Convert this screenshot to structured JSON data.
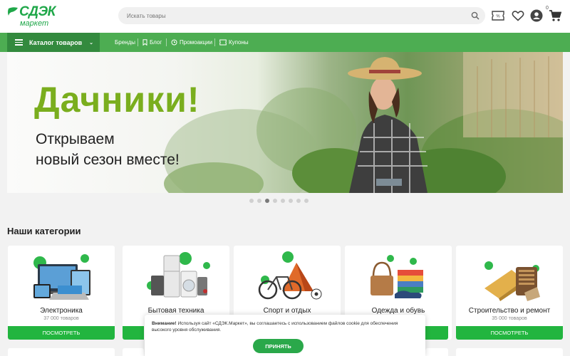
{
  "brand": {
    "name": "СДЭК",
    "sub": "маркет",
    "color": "#1fa749"
  },
  "search": {
    "placeholder": "Искать товары"
  },
  "header_icons": [
    "coupon-icon",
    "heart-icon",
    "user-icon",
    "cart-icon"
  ],
  "cart": {
    "count": "0"
  },
  "nav": {
    "catalog_label": "Каталог товаров",
    "links": [
      {
        "label": "Бренды"
      },
      {
        "label": "Блог",
        "icon": "bookmark-icon"
      },
      {
        "label": "Промоакции",
        "icon": "promo-icon"
      },
      {
        "label": "Купоны",
        "icon": "coupon-icon"
      }
    ]
  },
  "banner": {
    "title": "Дачники!",
    "subtitle_line1": "Открываем",
    "subtitle_line2": "новый сезон вместе!",
    "slide_count": 8,
    "active_slide": 3
  },
  "categories": {
    "title": "Наши категории",
    "items": [
      {
        "name": "Электроника",
        "count": "37 000 товаров",
        "button": "ПОСМОТРЕТЬ"
      },
      {
        "name": "Бытовая техника",
        "count": "",
        "button": ""
      },
      {
        "name": "Спорт и отдых",
        "count": "",
        "button": ""
      },
      {
        "name": "Одежда и обувь",
        "count": "",
        "button": ""
      },
      {
        "name": "Строительство и ремонт",
        "count": "35 000 товаров",
        "button": "ПОСМОТРЕТЬ"
      }
    ]
  },
  "cookie": {
    "bold": "Внимание!",
    "text": "Используя сайт «СДЭК.Маркет», вы соглашаетесь с использованием файлов cookie для обеспечения высокого уровня обслуживания.",
    "accept": "ПРИНЯТЬ"
  },
  "colors": {
    "green": "#4dad52",
    "dark_green": "#338a3e",
    "button_green": "#22b53f",
    "title_green": "#7aae1e"
  }
}
